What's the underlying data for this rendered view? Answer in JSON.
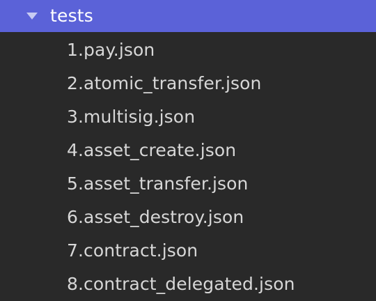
{
  "folder": {
    "label": "tests",
    "icon": "chevron-down-icon",
    "expanded": true
  },
  "files": [
    {
      "label": "1.pay.json"
    },
    {
      "label": "2.atomic_transfer.json"
    },
    {
      "label": "3.multisig.json"
    },
    {
      "label": "4.asset_create.json"
    },
    {
      "label": "5.asset_transfer.json"
    },
    {
      "label": "6.asset_destroy.json"
    },
    {
      "label": "7.contract.json"
    },
    {
      "label": "8.contract_delegated.json"
    }
  ],
  "colors": {
    "background": "#292929",
    "selection": "#5b62d8",
    "text": "#d7d7d7",
    "selected_text": "#ffffff"
  }
}
